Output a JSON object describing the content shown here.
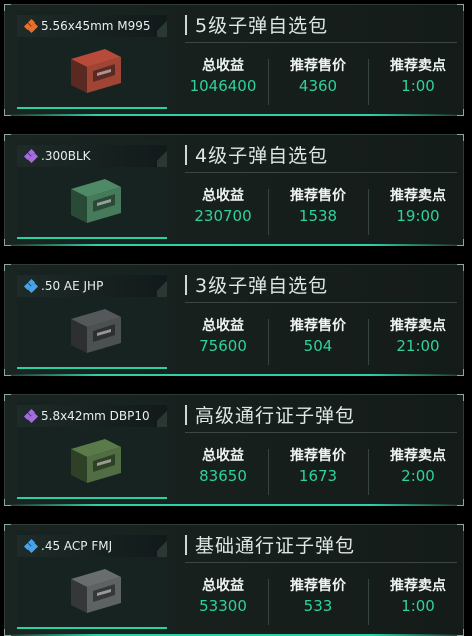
{
  "cards": [
    {
      "ammo": "5.56x45mm M995",
      "rarity_color": "#e8702a",
      "box_color": "#b84a3a",
      "box_stripe": "#5a2a22",
      "title": "5级子弹自选包",
      "stats": [
        {
          "label": "总收益",
          "value": "1046400"
        },
        {
          "label": "推荐售价",
          "value": "4360"
        },
        {
          "label": "推荐卖点",
          "value": "1:00"
        }
      ]
    },
    {
      "ammo": ".300BLK",
      "rarity_color": "#a66bdf",
      "box_color": "#4f8a66",
      "box_stripe": "#2a4a38",
      "title": "4级子弹自选包",
      "stats": [
        {
          "label": "总收益",
          "value": "230700"
        },
        {
          "label": "推荐售价",
          "value": "1538"
        },
        {
          "label": "推荐卖点",
          "value": "19:00"
        }
      ]
    },
    {
      "ammo": ".50 AE JHP",
      "rarity_color": "#4aa3e8",
      "box_color": "#55585a",
      "box_stripe": "#2d2f30",
      "title": "3级子弹自选包",
      "stats": [
        {
          "label": "总收益",
          "value": "75600"
        },
        {
          "label": "推荐售价",
          "value": "504"
        },
        {
          "label": "推荐卖点",
          "value": "21:00"
        }
      ]
    },
    {
      "ammo": "5.8x42mm DBP10",
      "rarity_color": "#a66bdf",
      "box_color": "#5b7a4a",
      "box_stripe": "#2e4026",
      "title": "高级通行证子弹包",
      "stats": [
        {
          "label": "总收益",
          "value": "83650"
        },
        {
          "label": "推荐售价",
          "value": "1673"
        },
        {
          "label": "推荐卖点",
          "value": "2:00"
        }
      ]
    },
    {
      "ammo": ".45 ACP FMJ",
      "rarity_color": "#4aa3e8",
      "box_color": "#6a6d6e",
      "box_stripe": "#353738",
      "title": "基础通行证子弹包",
      "stats": [
        {
          "label": "总收益",
          "value": "53300"
        },
        {
          "label": "推荐售价",
          "value": "533"
        },
        {
          "label": "推荐卖点",
          "value": "1:00"
        }
      ]
    }
  ]
}
